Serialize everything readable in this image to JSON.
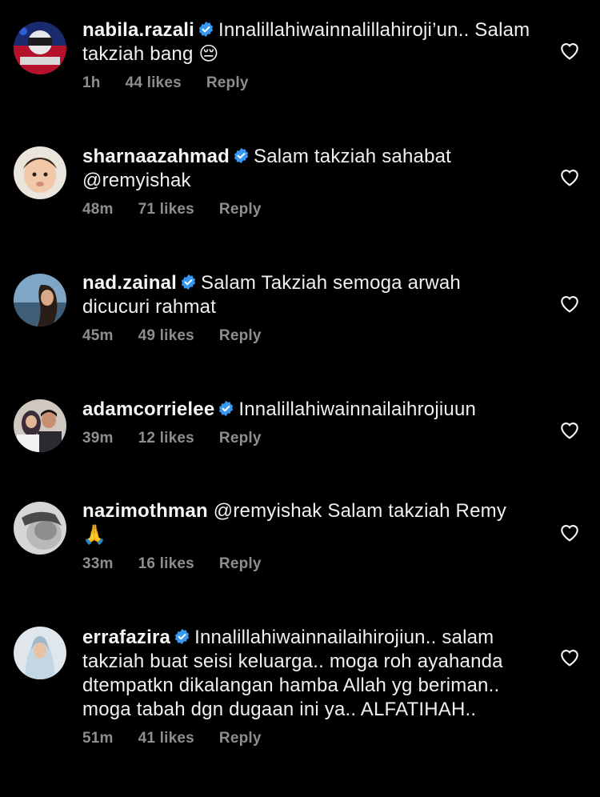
{
  "comments": [
    {
      "username": "nabila.razali",
      "verified": true,
      "text": "Innalillahiwainnalillahiroji’un.. Salam takziah bang 😔",
      "time": "1h",
      "likes": "44 likes",
      "reply": "Reply"
    },
    {
      "username": "sharnaazahmad",
      "verified": true,
      "text": "Salam takziah sahabat @remyishak",
      "time": "48m",
      "likes": "71 likes",
      "reply": "Reply"
    },
    {
      "username": "nad.zainal",
      "verified": true,
      "text": "Salam Takziah semoga arwah dicucuri rahmat",
      "time": "45m",
      "likes": "49 likes",
      "reply": "Reply"
    },
    {
      "username": "adamcorrielee",
      "verified": true,
      "text": "Innalillahiwainnailaihrojiuun",
      "time": "39m",
      "likes": "12 likes",
      "reply": "Reply"
    },
    {
      "username": "nazimothman",
      "verified": false,
      "text": "@remyishak Salam takziah Remy 🙏",
      "time": "33m",
      "likes": "16 likes",
      "reply": "Reply"
    },
    {
      "username": "errafazira",
      "verified": true,
      "text": "Innalillahiwainnailaihirojiun.. salam takziah buat seisi keluarga.. moga roh ayahanda dtempatkn dikalangan hamba Allah yg beriman.. moga tabah dgn dugaan ini ya.. ALFATIHAH..",
      "time": "51m",
      "likes": "41 likes",
      "reply": "Reply"
    }
  ],
  "icons": {
    "verified": "verified-badge-icon",
    "like": "heart-outline-icon"
  },
  "colors": {
    "background": "#000000",
    "text": "#f5f5f5",
    "meta": "#8e8e8e",
    "verified": "#3897f0"
  }
}
